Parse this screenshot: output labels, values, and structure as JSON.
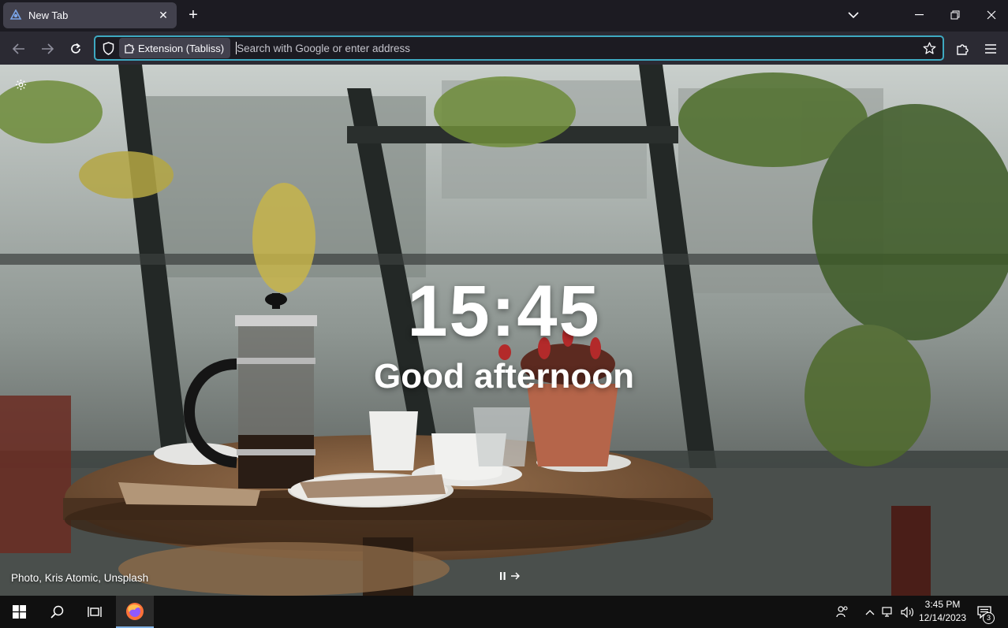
{
  "browser": {
    "tab": {
      "title": "New Tab",
      "favicon": "tabliss-icon"
    },
    "urlbar": {
      "identity_label": "Extension (Tabliss)",
      "placeholder": "Search with Google or enter address",
      "value": ""
    },
    "accent_color": "#3ea9c1"
  },
  "newtab": {
    "time": "15:45",
    "greeting": "Good afternoon",
    "photo_credit": "Photo, Kris Atomic, Unsplash"
  },
  "taskbar": {
    "time": "3:45 PM",
    "date": "12/14/2023",
    "notification_count": "3"
  }
}
